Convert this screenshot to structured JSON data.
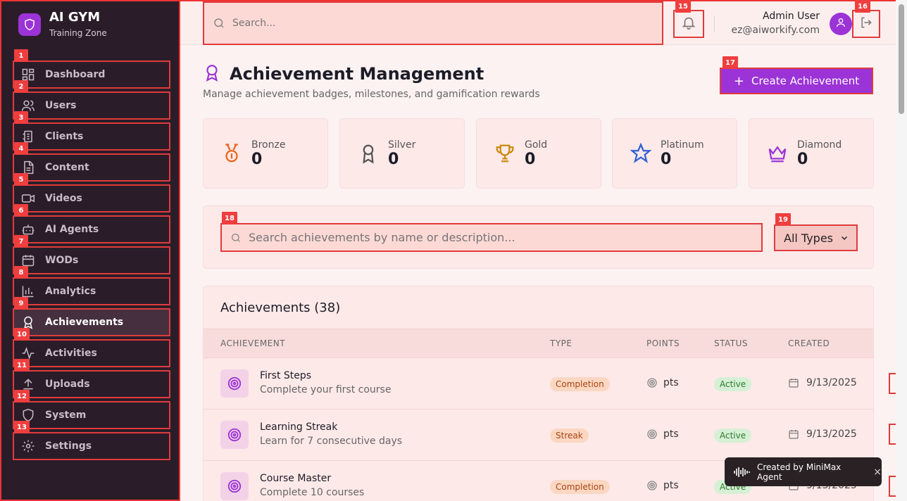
{
  "brand": {
    "title": "AI GYM",
    "subtitle": "Training Zone"
  },
  "sidebar": {
    "items": [
      {
        "label": "Dashboard",
        "badge": "1",
        "icon": "dashboard-icon"
      },
      {
        "label": "Users",
        "badge": "2",
        "icon": "users-icon"
      },
      {
        "label": "Clients",
        "badge": "3",
        "icon": "clients-icon"
      },
      {
        "label": "Content",
        "badge": "4",
        "icon": "document-icon"
      },
      {
        "label": "Videos",
        "badge": "5",
        "icon": "video-icon"
      },
      {
        "label": "AI Agents",
        "badge": "6",
        "icon": "bot-icon"
      },
      {
        "label": "WODs",
        "badge": "7",
        "icon": "calendar-icon"
      },
      {
        "label": "Analytics",
        "badge": "8",
        "icon": "bar-chart-icon"
      },
      {
        "label": "Achievements",
        "badge": "9",
        "icon": "award-icon",
        "active": true
      },
      {
        "label": "Activities",
        "badge": "10",
        "icon": "activity-icon"
      },
      {
        "label": "Uploads",
        "badge": "11",
        "icon": "upload-icon"
      },
      {
        "label": "System",
        "badge": "12",
        "icon": "shield-icon"
      },
      {
        "label": "Settings",
        "badge": "13",
        "icon": "gear-icon"
      }
    ]
  },
  "topbar": {
    "search_placeholder": "Search...",
    "bell_badge": "15",
    "logout_badge": "16",
    "user_name": "Admin User",
    "user_email": "ez@aiworkify.com"
  },
  "page": {
    "title": "Achievement Management",
    "subtitle": "Manage achievement badges, milestones, and gamification rewards",
    "create_label": "Create Achievement",
    "create_badge": "17"
  },
  "stats": [
    {
      "label": "Bronze",
      "value": "0",
      "color": "#e8651a",
      "icon": "medal-icon"
    },
    {
      "label": "Silver",
      "value": "0",
      "color": "#555555",
      "icon": "award-icon"
    },
    {
      "label": "Gold",
      "value": "0",
      "color": "#c98a0c",
      "icon": "trophy-icon"
    },
    {
      "label": "Platinum",
      "value": "0",
      "color": "#2f5fd6",
      "icon": "star-icon"
    },
    {
      "label": "Diamond",
      "value": "0",
      "color": "#9b33d6",
      "icon": "crown-icon"
    }
  ],
  "filters": {
    "search_placeholder": "Search achievements by name or description...",
    "search_badge": "18",
    "type_selected": "All Types",
    "type_badge": "19"
  },
  "table": {
    "title": "Achievements (38)",
    "headers": [
      "ACHIEVEMENT",
      "TYPE",
      "POINTS",
      "STATUS",
      "CREATED"
    ],
    "rows": [
      {
        "name": "First Steps",
        "desc": "Complete your first course",
        "type": "Completion",
        "points": "pts",
        "status": "Active",
        "created": "9/13/2025"
      },
      {
        "name": "Learning Streak",
        "desc": "Learn for 7 consecutive days",
        "type": "Streak",
        "points": "pts",
        "status": "Active",
        "created": "9/13/2025"
      },
      {
        "name": "Course Master",
        "desc": "Complete 10 courses",
        "type": "Completion",
        "points": "pts",
        "status": "Active",
        "created": "9/13/2025"
      }
    ]
  },
  "toast": {
    "text": "Created by MiniMax Agent",
    "close": "×"
  },
  "colors": {
    "accent": "#9b33d6",
    "sidebar_bg": "#2a1d29",
    "highlight": "#e03b3b"
  }
}
